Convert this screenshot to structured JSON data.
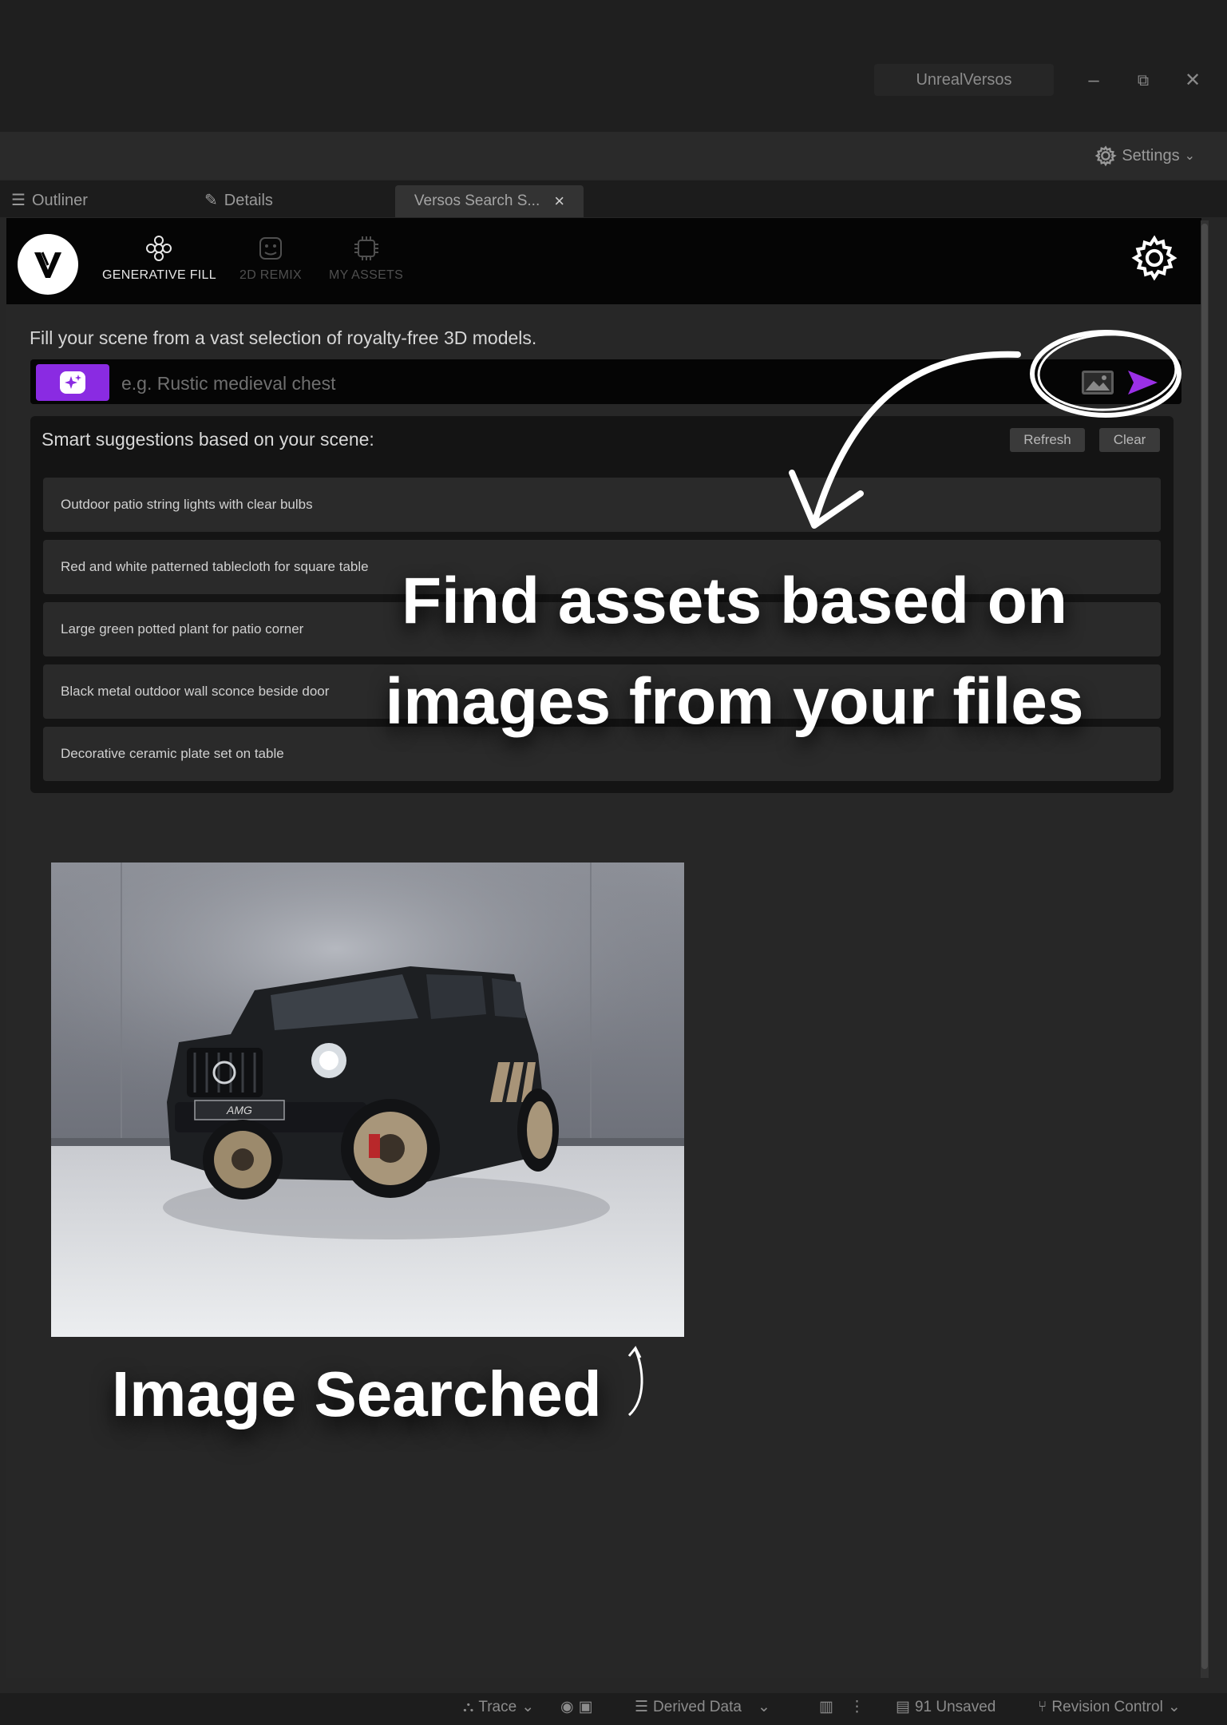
{
  "window": {
    "title": "UnrealVersos",
    "minimize_glyph": "–",
    "restore_glyph": "⧉",
    "close_glyph": "✕"
  },
  "toolbar": {
    "settings_label": "Settings"
  },
  "tabs": [
    {
      "label": "Outliner",
      "icon": "list-icon"
    },
    {
      "label": "Details",
      "icon": "pencil-icon"
    },
    {
      "label": "Versos Search S...",
      "close": "×"
    }
  ],
  "plugin": {
    "nav": [
      {
        "label": "GENERATIVE FILL",
        "active": true,
        "icon": "flower-icon"
      },
      {
        "label": "2D REMIX",
        "active": false,
        "icon": "face-icon"
      },
      {
        "label": "MY ASSETS",
        "active": false,
        "icon": "chip-icon"
      }
    ],
    "intro": "Fill your scene from a vast selection of royalty-free 3D models.",
    "search": {
      "placeholder": "e.g. Rustic medieval chest",
      "value": ""
    },
    "suggestions": {
      "title": "Smart suggestions based on your scene:",
      "refresh_label": "Refresh",
      "clear_label": "Clear",
      "items": [
        "Outdoor patio string lights with clear bulbs",
        "Red and white patterned tablecloth for square table",
        "Large green potted plant for patio corner",
        "Black metal outdoor wall sconce beside door",
        "Decorative ceramic plate set on table"
      ]
    }
  },
  "overlay": {
    "headline_line1": "Find assets based on",
    "headline_line2": "images from your files",
    "caption": "Image Searched",
    "car_plate": "AMG"
  },
  "statusbar": {
    "trace": "Trace",
    "derived_data": "Derived Data",
    "unsaved": "91 Unsaved",
    "revision_control": "Revision Control"
  },
  "colors": {
    "accent": "#8a2be2",
    "panel_bg": "#272727",
    "header_bg": "#050505"
  }
}
